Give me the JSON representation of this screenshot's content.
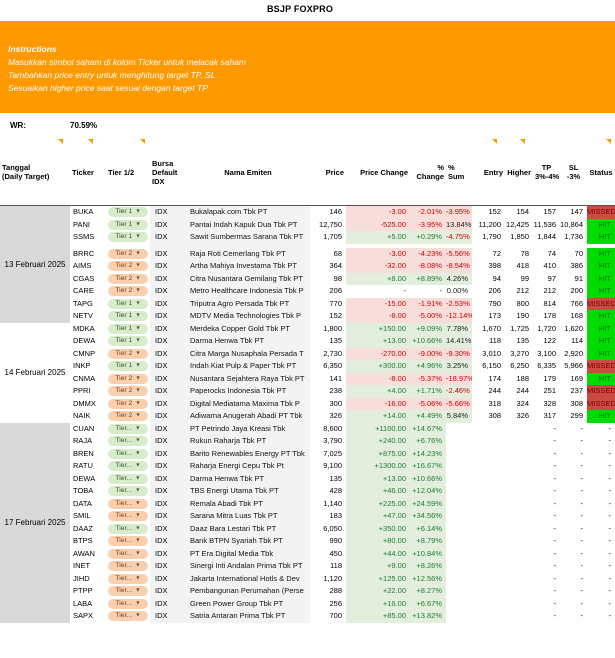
{
  "title": "BSJP FOXPRO",
  "instructions": {
    "heading": "Instructions",
    "lines": [
      "Masukkan simbol saham di kolom Ticker untuk melacak saham",
      "Tambahkan price entry untuk menghitung target TP, SL",
      "Sesuaikan higher price saat sesuai dengan target TP"
    ]
  },
  "wr": {
    "label": "WR:",
    "value": "70.59%"
  },
  "colors": {
    "instructions_bg": "#ff9900",
    "note_indicator": "#ff9900",
    "date_block_gray": "#d9d9d9",
    "column_gray": "#f3f3f3",
    "band_positive": "#e3eedd",
    "band_negative": "#f8dedb",
    "text_positive": "#1e7e34",
    "text_negative": "#cc0000",
    "hit_bg": "#00dc00",
    "hit_text": "#007200",
    "missed_bg": "#cb4a42",
    "missed_text": "#750000",
    "tier1_bg": "#d6eccb",
    "tier2_bg": "#f9cfae"
  },
  "table": {
    "headers": {
      "tanggal": "Tanggal\n(Daily Target)",
      "ticker": "Ticker",
      "tier": "Tier 1/2",
      "bursa": "Bursa\nDefault IDX",
      "nama": "Nama Emiten",
      "price": "Price",
      "price_change": "Price Change",
      "pct_change": "% Change",
      "pct_sum": "% Sum",
      "entry": "Entry",
      "higher": "Higher",
      "tp": "TP\n3%-4%",
      "sl": "SL\n-3%",
      "status": "Status"
    },
    "groups": [
      {
        "date": "13 Februari 2025",
        "shaded": true,
        "rows": [
          {
            "ticker": "BUKA",
            "tier": "Tier 1",
            "tier_type": "green",
            "bursa": "IDX",
            "name": "Bukalapak.com Tbk PT",
            "price": "146",
            "price_change": "-3.00",
            "pct_change": "-2.01%",
            "pct_sum": "-3.95%",
            "entry": "152",
            "higher": "154",
            "tp": "157",
            "sl": "147",
            "status": "MISSED",
            "sign": "neg"
          },
          {
            "ticker": "PANI",
            "tier": "Tier 1",
            "tier_type": "green",
            "bursa": "IDX",
            "name": "Pantai Indah Kapuk Dua Tbk PT",
            "price": "12,750",
            "price_change": "-525.00",
            "pct_change": "-3.95%",
            "pct_sum": "13.84%",
            "entry": "11,200",
            "higher": "12,425",
            "tp": "11,536",
            "sl": "10,864",
            "status": "HIT",
            "sign": "neg",
            "note": true
          },
          {
            "ticker": "SSMS",
            "tier": "Tier 1",
            "tier_type": "green",
            "bursa": "IDX",
            "name": "Sawit Sumbermas Sarana Tbk PT",
            "price": "1,705",
            "price_change": "+5.00",
            "pct_change": "+0.29%",
            "pct_sum": "-4.75%",
            "entry": "1,790",
            "higher": "1,850",
            "tp": "1,844",
            "sl": "1,736",
            "status": "HIT",
            "sign": "pos",
            "gap_after": true
          },
          {
            "ticker": "BRRC",
            "tier": "Tier 2",
            "tier_type": "orange",
            "bursa": "IDX",
            "name": "Raja Roti Cemerlang Tbk PT",
            "price": "68",
            "price_change": "-3.00",
            "pct_change": "-4.23%",
            "pct_sum": "-5.56%",
            "entry": "72",
            "higher": "78",
            "tp": "74",
            "sl": "70",
            "status": "HIT",
            "sign": "neg"
          },
          {
            "ticker": "AIMS",
            "tier": "Tier 2",
            "tier_type": "orange",
            "bursa": "IDX",
            "name": "Artha Mahiya Investama Tbk PT",
            "price": "364",
            "price_change": "-32.00",
            "pct_change": "-8.08%",
            "pct_sum": "-8.54%",
            "entry": "398",
            "higher": "418",
            "tp": "410",
            "sl": "386",
            "status": "HIT",
            "sign": "neg"
          },
          {
            "ticker": "CGAS",
            "tier": "Tier 2",
            "tier_type": "orange",
            "bursa": "IDX",
            "name": "Citra Nusantara Gemilang Tbk PT",
            "price": "98",
            "price_change": "+8.00",
            "pct_change": "+8.89%",
            "pct_sum": "4.26%",
            "entry": "94",
            "higher": "99",
            "tp": "97",
            "sl": "91",
            "status": "HIT",
            "sign": "pos"
          },
          {
            "ticker": "CARE",
            "tier": "Tier 2",
            "tier_type": "orange",
            "bursa": "IDX",
            "name": "Metro Healthcare Indonesia Tbk P",
            "price": "206",
            "price_change": "-",
            "pct_change": "-",
            "pct_sum": "0.00%",
            "entry": "206",
            "higher": "212",
            "tp": "212",
            "sl": "200",
            "status": "HIT",
            "sign": "none"
          },
          {
            "ticker": "TAPG",
            "tier": "Tier 1",
            "tier_type": "green",
            "bursa": "IDX",
            "name": "Triputra Agro Persada Tbk PT",
            "price": "770",
            "price_change": "-15.00",
            "pct_change": "-1.91%",
            "pct_sum": "-2.53%",
            "entry": "790",
            "higher": "800",
            "tp": "814",
            "sl": "766",
            "status": "MISSED",
            "sign": "neg"
          },
          {
            "ticker": "NETV",
            "tier": "Tier 1",
            "tier_type": "green",
            "bursa": "IDX",
            "name": "MDTV Media Technologies Tbk P",
            "price": "152",
            "price_change": "-8.00",
            "pct_change": "-5.00%",
            "pct_sum": "-12.14%",
            "entry": "173",
            "higher": "190",
            "tp": "178",
            "sl": "168",
            "status": "HIT",
            "sign": "neg"
          }
        ]
      },
      {
        "date": "14 Februari 2025",
        "shaded": false,
        "rows": [
          {
            "ticker": "MDKA",
            "tier": "Tier 1",
            "tier_type": "green",
            "bursa": "IDX",
            "name": "Merdeka Copper Gold Tbk PT",
            "price": "1,800",
            "price_change": "+150.00",
            "pct_change": "+9.09%",
            "pct_sum": "7.78%",
            "entry": "1,670",
            "higher": "1,725",
            "tp": "1,720",
            "sl": "1,620",
            "status": "HIT",
            "sign": "pos"
          },
          {
            "ticker": "DEWA",
            "tier": "Tier 1",
            "tier_type": "green",
            "bursa": "IDX",
            "name": "Darma Henwa Tbk PT",
            "price": "135",
            "price_change": "+13.00",
            "pct_change": "+10.66%",
            "pct_sum": "14.41%",
            "entry": "118",
            "higher": "135",
            "tp": "122",
            "sl": "114",
            "status": "HIT",
            "sign": "pos"
          },
          {
            "ticker": "CMNP",
            "tier": "Tier 2",
            "tier_type": "orange",
            "bursa": "IDX",
            "name": "Citra Marga Nusaphala Persada T",
            "price": "2,730",
            "price_change": "-270.00",
            "pct_change": "-9.00%",
            "pct_sum": "-9.30%",
            "entry": "3,010",
            "higher": "3,270",
            "tp": "3,100",
            "sl": "2,920",
            "status": "HIT",
            "sign": "neg"
          },
          {
            "ticker": "INKP",
            "tier": "Tier 1",
            "tier_type": "green",
            "bursa": "IDX",
            "name": "Indah Kiat Pulp & Paper Tbk PT",
            "price": "6,350",
            "price_change": "+300.00",
            "pct_change": "+4.96%",
            "pct_sum": "3.25%",
            "entry": "6,150",
            "higher": "6,250",
            "tp": "6,335",
            "sl": "5,966",
            "status": "MISSED",
            "sign": "pos"
          },
          {
            "ticker": "CNMA",
            "tier": "Tier 2",
            "tier_type": "orange",
            "bursa": "IDX",
            "name": "Nusantara Sejahtera Raya Tbk PT",
            "price": "141",
            "price_change": "-8.00",
            "pct_change": "-5.37%",
            "pct_sum": "-18.97%",
            "entry": "174",
            "higher": "188",
            "tp": "179",
            "sl": "169",
            "status": "HIT",
            "sign": "neg"
          },
          {
            "ticker": "PPRI",
            "tier": "Tier 2",
            "tier_type": "orange",
            "bursa": "IDX",
            "name": "Paperocks Indonesia Tbk PT",
            "price": "238",
            "price_change": "+4.00",
            "pct_change": "+1.71%",
            "pct_sum": "-2.46%",
            "entry": "244",
            "higher": "244",
            "tp": "251",
            "sl": "237",
            "status": "MISSED",
            "sign": "pos"
          },
          {
            "ticker": "DMMX",
            "tier": "Tier 2",
            "tier_type": "orange",
            "bursa": "IDX",
            "name": "Digital Mediatama Maxima Tbk P",
            "price": "300",
            "price_change": "-16.00",
            "pct_change": "-5.06%",
            "pct_sum": "-5.66%",
            "entry": "318",
            "higher": "324",
            "tp": "328",
            "sl": "308",
            "status": "MISSED",
            "sign": "neg"
          },
          {
            "ticker": "NAIK",
            "tier": "Tier 2",
            "tier_type": "orange",
            "bursa": "IDX",
            "name": "Adiwarna Anugerah Abadi PT Tbk",
            "price": "326",
            "price_change": "+14.00",
            "pct_change": "+4.49%",
            "pct_sum": "5.84%",
            "entry": "308",
            "higher": "326",
            "tp": "317",
            "sl": "299",
            "status": "HIT",
            "sign": "pos"
          }
        ]
      },
      {
        "date": "17 Februari 2025",
        "shaded": true,
        "rows": [
          {
            "ticker": "CUAN",
            "tier": "Tier...",
            "tier_type": "green",
            "bursa": "IDX",
            "name": "PT Petrindo Jaya Kreasi Tbk",
            "price": "8,600",
            "price_change": "+1100.00",
            "pct_change": "+14.67%",
            "pct_sum": "",
            "entry": "",
            "higher": "",
            "tp": "-",
            "sl": "-",
            "status": "-",
            "sign": "pos",
            "open": true
          },
          {
            "ticker": "RAJA",
            "tier": "Tier...",
            "tier_type": "green",
            "bursa": "IDX",
            "name": "Rukun Raharja Tbk PT",
            "price": "3,790",
            "price_change": "+240.00",
            "pct_change": "+6.76%",
            "pct_sum": "",
            "entry": "",
            "higher": "",
            "tp": "-",
            "sl": "-",
            "status": "-",
            "sign": "pos",
            "open": true
          },
          {
            "ticker": "BREN",
            "tier": "Tier...",
            "tier_type": "green",
            "bursa": "IDX",
            "name": "Barito Renewables Energy PT Tbk",
            "price": "7,025",
            "price_change": "+875.00",
            "pct_change": "+14.23%",
            "pct_sum": "",
            "entry": "",
            "higher": "",
            "tp": "-",
            "sl": "-",
            "status": "-",
            "sign": "pos",
            "open": true
          },
          {
            "ticker": "RATU",
            "tier": "Tier...",
            "tier_type": "green",
            "bursa": "IDX",
            "name": "Raharja Energi Cepu Tbk Pt",
            "price": "9,100",
            "price_change": "+1300.00",
            "pct_change": "+16.67%",
            "pct_sum": "",
            "entry": "",
            "higher": "",
            "tp": "-",
            "sl": "-",
            "status": "-",
            "sign": "pos",
            "open": true
          },
          {
            "ticker": "DEWA",
            "tier": "Tier...",
            "tier_type": "green",
            "bursa": "IDX",
            "name": "Darma Henwa Tbk PT",
            "price": "135",
            "price_change": "+13.00",
            "pct_change": "+10.66%",
            "pct_sum": "",
            "entry": "",
            "higher": "",
            "tp": "-",
            "sl": "-",
            "status": "-",
            "sign": "pos",
            "open": true
          },
          {
            "ticker": "TOBA",
            "tier": "Tier...",
            "tier_type": "green",
            "bursa": "IDX",
            "name": "TBS Energi Utama Tbk PT",
            "price": "428",
            "price_change": "+46.00",
            "pct_change": "+12.04%",
            "pct_sum": "",
            "entry": "",
            "higher": "",
            "tp": "-",
            "sl": "-",
            "status": "-",
            "sign": "pos",
            "open": true
          },
          {
            "ticker": "DATA",
            "tier": "Tier...",
            "tier_type": "orange",
            "bursa": "IDX",
            "name": "Remala Abadi Tbk PT",
            "price": "1,140",
            "price_change": "+225.00",
            "pct_change": "+24.59%",
            "pct_sum": "",
            "entry": "",
            "higher": "",
            "tp": "-",
            "sl": "-",
            "status": "-",
            "sign": "pos",
            "open": true
          },
          {
            "ticker": "SMIL",
            "tier": "Tier...",
            "tier_type": "orange",
            "bursa": "IDX",
            "name": "Sarana Mitra Luas Tbk PT",
            "price": "183",
            "price_change": "+47.00",
            "pct_change": "+34.56%",
            "pct_sum": "",
            "entry": "",
            "higher": "",
            "tp": "-",
            "sl": "-",
            "status": "-",
            "sign": "pos",
            "open": true
          },
          {
            "ticker": "DAAZ",
            "tier": "Tier...",
            "tier_type": "green",
            "bursa": "IDX",
            "name": "Daaz Bara Lestari Tbk PT",
            "price": "6,050",
            "price_change": "+350.00",
            "pct_change": "+6.14%",
            "pct_sum": "",
            "entry": "",
            "higher": "",
            "tp": "-",
            "sl": "-",
            "status": "-",
            "sign": "pos",
            "open": true
          },
          {
            "ticker": "BTPS",
            "tier": "Tier...",
            "tier_type": "orange",
            "bursa": "IDX",
            "name": "Bank BTPN Syariah Tbk PT",
            "price": "990",
            "price_change": "+80.00",
            "pct_change": "+8.79%",
            "pct_sum": "",
            "entry": "",
            "higher": "",
            "tp": "-",
            "sl": "-",
            "status": "-",
            "sign": "pos",
            "open": true
          },
          {
            "ticker": "AWAN",
            "tier": "Tier...",
            "tier_type": "orange",
            "bursa": "IDX",
            "name": "PT Era Digital Media Tbk",
            "price": "450",
            "price_change": "+44.00",
            "pct_change": "+10.84%",
            "pct_sum": "",
            "entry": "",
            "higher": "",
            "tp": "-",
            "sl": "-",
            "status": "-",
            "sign": "pos",
            "open": true
          },
          {
            "ticker": "INET",
            "tier": "Tier...",
            "tier_type": "orange",
            "bursa": "IDX",
            "name": "Sinergi Inti Andalan Prima Tbk PT",
            "price": "118",
            "price_change": "+9.00",
            "pct_change": "+8.26%",
            "pct_sum": "",
            "entry": "",
            "higher": "",
            "tp": "-",
            "sl": "-",
            "status": "-",
            "sign": "pos",
            "open": true
          },
          {
            "ticker": "JIHD",
            "tier": "Tier...",
            "tier_type": "orange",
            "bursa": "IDX",
            "name": "Jakarta International Hotls & Dev",
            "price": "1,120",
            "price_change": "+125.00",
            "pct_change": "+12.56%",
            "pct_sum": "",
            "entry": "",
            "higher": "",
            "tp": "-",
            "sl": "-",
            "status": "-",
            "sign": "pos",
            "open": true
          },
          {
            "ticker": "PTPP",
            "tier": "Tier...",
            "tier_type": "orange",
            "bursa": "IDX",
            "name": "Pembangunan Perumahan (Perse",
            "price": "288",
            "price_change": "+22.00",
            "pct_change": "+8.27%",
            "pct_sum": "",
            "entry": "",
            "higher": "",
            "tp": "-",
            "sl": "-",
            "status": "-",
            "sign": "pos",
            "open": true
          },
          {
            "ticker": "LABA",
            "tier": "Tier...",
            "tier_type": "orange",
            "bursa": "IDX",
            "name": "Green Power Group Tbk PT",
            "price": "256",
            "price_change": "+16.00",
            "pct_change": "+6.67%",
            "pct_sum": "",
            "entry": "",
            "higher": "",
            "tp": "-",
            "sl": "-",
            "status": "-",
            "sign": "pos",
            "open": true
          },
          {
            "ticker": "SAPX",
            "tier": "Tier...",
            "tier_type": "orange",
            "bursa": "IDX",
            "name": "Satria Antaran Prima Tbk PT",
            "price": "700",
            "price_change": "+85.00",
            "pct_change": "+13.82%",
            "pct_sum": "",
            "entry": "",
            "higher": "",
            "tp": "-",
            "sl": "-",
            "status": "-",
            "sign": "pos",
            "open": true
          }
        ]
      }
    ]
  }
}
